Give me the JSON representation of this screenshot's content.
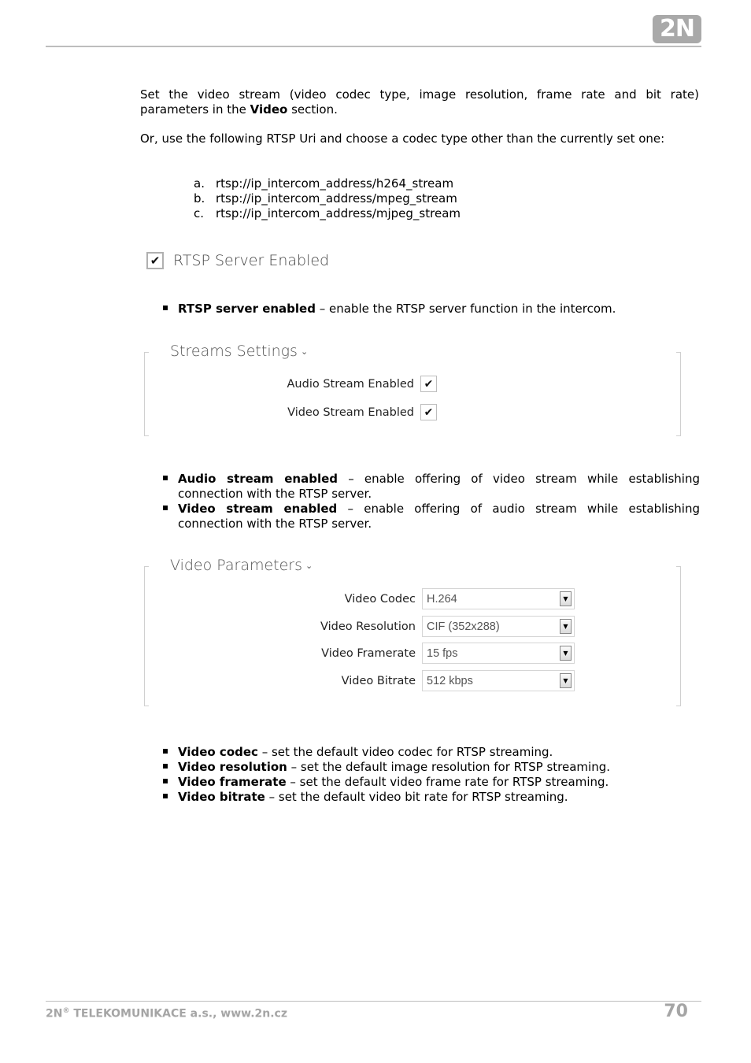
{
  "header": {
    "logo_text": "2N"
  },
  "intro": {
    "p1_before": "Set the video stream (video codec type, image resolution, frame rate and bit rate) parameters in the ",
    "p1_bold": "Video",
    "p1_after": " section.",
    "p2": "Or, use the following RTSP Uri and choose a codec type other than the currently set one:"
  },
  "uris": [
    {
      "marker": "a.",
      "text": "rtsp://ip_intercom_address/h264_stream"
    },
    {
      "marker": "b.",
      "text": "rtsp://ip_intercom_address/mpeg_stream"
    },
    {
      "marker": "c.",
      "text": "rtsp://ip_intercom_address/mjpeg_stream"
    }
  ],
  "rtsp_server": {
    "label": "RTSP Server Enabled",
    "checked": true,
    "check_glyph": "✔"
  },
  "bullets_rtsp": [
    {
      "term": "RTSP server enabled",
      "desc": " – enable the RTSP server function in the intercom."
    }
  ],
  "streams_settings": {
    "title": "Streams Settings",
    "chevron": "⌄",
    "items": [
      {
        "label": "Audio Stream Enabled",
        "checked": true,
        "check_glyph": "✔"
      },
      {
        "label": "Video Stream Enabled",
        "checked": true,
        "check_glyph": "✔"
      }
    ]
  },
  "bullets_streams": [
    {
      "term": "Audio stream enabled",
      "desc": " – enable offering of video stream while establishing connection with the RTSP server."
    },
    {
      "term": "Video stream enabled",
      "desc": " –  enable offering of audio stream while establishing connection with the RTSP server."
    }
  ],
  "video_parameters": {
    "title": "Video Parameters",
    "chevron": "⌄",
    "arrow_glyph": "▼",
    "fields": [
      {
        "label": "Video Codec",
        "value": "H.264"
      },
      {
        "label": "Video Resolution",
        "value": "CIF (352x288)"
      },
      {
        "label": "Video Framerate",
        "value": "15 fps"
      },
      {
        "label": "Video Bitrate",
        "value": "512 kbps"
      }
    ]
  },
  "bullets_video": [
    {
      "term": "Video codec",
      "desc": " – set the default video codec for RTSP streaming."
    },
    {
      "term": "Video resolution",
      "desc": " – set the default image resolution for RTSP streaming."
    },
    {
      "term": "Video framerate",
      "desc": " – set the default video frame rate for RTSP streaming."
    },
    {
      "term": "Video bitrate",
      "desc": " – set the default video bit rate for RTSP streaming."
    }
  ],
  "footer": {
    "company_prefix": "2N",
    "registered": "®",
    "company_rest": " TELEKOMUNIKACE a.s., www.2n.cz",
    "page_number": "70"
  }
}
